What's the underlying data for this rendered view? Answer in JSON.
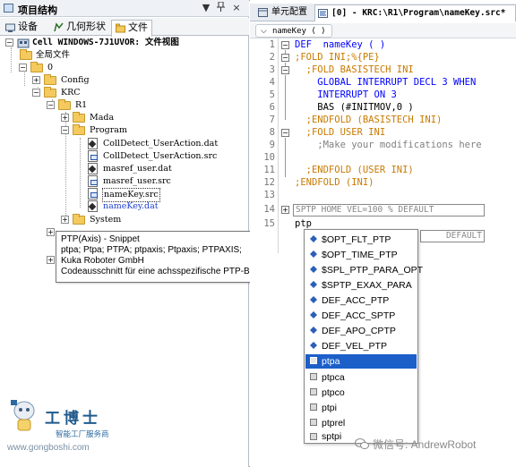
{
  "left_panel": {
    "title": "项目结构",
    "controls": {
      "dropdown": "▼",
      "pin": "ᵖ",
      "close": "×"
    },
    "tabs": [
      {
        "label": "设备",
        "icon": "device-icon"
      },
      {
        "label": "几何形状",
        "icon": "geometry-icon"
      },
      {
        "label": "文件",
        "icon": "files-icon",
        "active": true
      }
    ],
    "tree": {
      "root": "Cell WINDOWS-7J1UVOR: 文件视图",
      "global_files": "全局文件",
      "zero": "0",
      "config": "Config",
      "krc": "KRC",
      "r1": "R1",
      "mada": "Mada",
      "program": "Program",
      "files": [
        "CollDetect_UserAction.dat",
        "CollDetect_UserAction.src",
        "masref_user.dat",
        "masref_user.src",
        "nameKey.src",
        "nameKey.dat"
      ],
      "system": "System"
    },
    "tooltip": {
      "title": "PTP(Axis) - Snippet",
      "line2": "ptpa; Ptpa; PTPA; ptpaxis; Ptpaxis; PTPAXIS;",
      "line3": "Kuka Roboter GmbH",
      "line4": "Codeausschnitt für eine achsspezifische PTP-Bewegung"
    }
  },
  "watermark": {
    "name": "工博士",
    "subtitle": "智能工厂服务商",
    "url": "www.gongboshi.com",
    "wechat": "微信号: AndrewRobot"
  },
  "editor": {
    "tabs": [
      {
        "label": "单元配置",
        "icon": "cell-config-icon"
      },
      {
        "label": "[0] - KRC:\\R1\\Program\\nameKey.src*",
        "icon": "code-file-icon",
        "active": true
      }
    ],
    "nav_combo": "nameKey ( )",
    "lines": [
      {
        "n": "1",
        "text": "DEF  nameKey ( )"
      },
      {
        "n": "2",
        "text": ";FOLD INI;%{PE}"
      },
      {
        "n": "3",
        "text": "  ;FOLD BASISTECH INI"
      },
      {
        "n": "4",
        "text": "    GLOBAL INTERRUPT DECL 3 WHEN"
      },
      {
        "n": "5",
        "text": "    INTERRUPT ON 3"
      },
      {
        "n": "6",
        "text": "    BAS (#INITMOV,0 )"
      },
      {
        "n": "7",
        "text": "  ;ENDFOLD (BASISTECH INI)"
      },
      {
        "n": "8",
        "text": "  ;FOLD USER INI"
      },
      {
        "n": "9",
        "text": "    ;Make your modifications here"
      },
      {
        "n": "10",
        "text": ""
      },
      {
        "n": "11",
        "text": "  ;ENDFOLD (USER INI)"
      },
      {
        "n": "12",
        "text": ";ENDFOLD (INI)"
      },
      {
        "n": "13",
        "text": ""
      },
      {
        "n": "14",
        "text": "SPTP HOME VEL=100 % DEFAULT"
      },
      {
        "n": "15",
        "text": "ptp"
      }
    ],
    "line16_tail": "DEFAULT"
  },
  "autocomplete": {
    "items": [
      {
        "label": "$OPT_FLT_PTP",
        "kind": "variable"
      },
      {
        "label": "$OPT_TIME_PTP",
        "kind": "variable"
      },
      {
        "label": "$SPL_PTP_PARA_OPT",
        "kind": "variable"
      },
      {
        "label": "$SPTP_EXAX_PARA",
        "kind": "variable"
      },
      {
        "label": "DEF_ACC_PTP",
        "kind": "variable"
      },
      {
        "label": "DEF_ACC_SPTP",
        "kind": "variable"
      },
      {
        "label": "DEF_APO_CPTP",
        "kind": "variable"
      },
      {
        "label": "DEF_VEL_PTP",
        "kind": "variable"
      },
      {
        "label": "ptpa",
        "kind": "snippet",
        "selected": true
      },
      {
        "label": "ptpca",
        "kind": "snippet"
      },
      {
        "label": "ptpco",
        "kind": "snippet"
      },
      {
        "label": "ptpi",
        "kind": "snippet"
      },
      {
        "label": "ptprel",
        "kind": "snippet"
      },
      {
        "label": "sptpi",
        "kind": "snippet"
      }
    ]
  },
  "colors": {
    "keyword": "#0000ff",
    "comment": "#808080",
    "fold": "#c87a00",
    "selection": "#1c5fc9",
    "folder": "#f4c95d"
  }
}
